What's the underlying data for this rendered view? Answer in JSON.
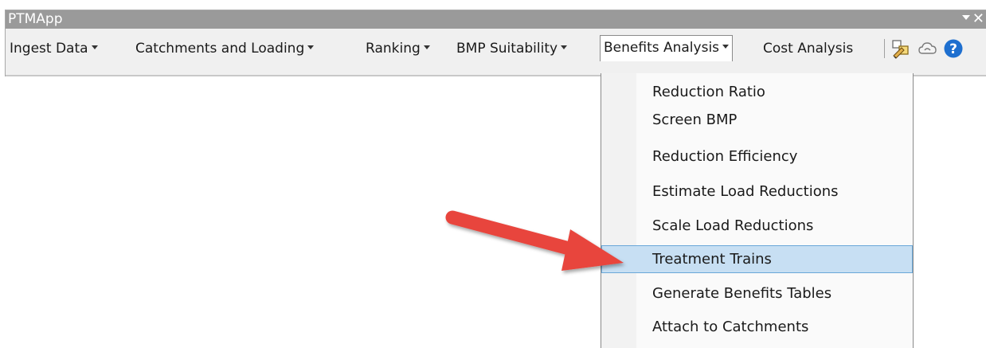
{
  "window": {
    "title": "PTMApp"
  },
  "toolbar": {
    "menus": [
      {
        "label": "Ingest Data"
      },
      {
        "label": "Catchments and Loading"
      },
      {
        "label": "Ranking"
      },
      {
        "label": "BMP Suitability"
      },
      {
        "label": "Benefits Analysis"
      }
    ],
    "cost_analysis": "Cost Analysis",
    "icons": [
      "edit-tools-icon",
      "cloud-icon",
      "help-icon"
    ]
  },
  "dropdown": {
    "items": [
      {
        "label": "Reduction Ratio"
      },
      {
        "label": "Screen BMP"
      },
      {
        "label": "Reduction Efficiency"
      },
      {
        "label": "Estimate Load Reductions"
      },
      {
        "label": "Scale Load Reductions"
      },
      {
        "label": "Treatment Trains",
        "highlighted": true
      },
      {
        "label": "Generate Benefits Tables"
      },
      {
        "label": "Attach to Catchments"
      }
    ]
  },
  "colors": {
    "titlebar": "#9a9a9a",
    "highlight": "#c7dff3",
    "annotation_arrow": "#e8453c",
    "help_icon": "#1e6fcf"
  }
}
